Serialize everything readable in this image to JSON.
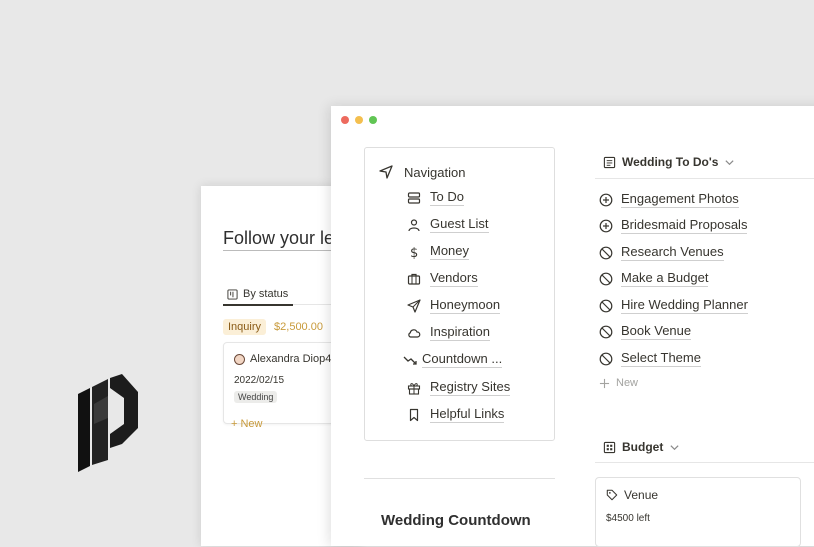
{
  "logo": {
    "name": "brand-logo"
  },
  "back_window": {
    "title": "Follow your le",
    "tab": {
      "label": "By status",
      "icon": "board-icon"
    },
    "group": {
      "status": "Inquiry",
      "amount": "$2,500.00"
    },
    "card": {
      "person": "Alexandra Diop4",
      "date": "2022/02/15",
      "tag": "Wedding"
    },
    "new_label": "+ New"
  },
  "front_window": {
    "traffic_lights": [
      "#ed6a5e",
      "#f4bf4f",
      "#61c554"
    ],
    "navigation": {
      "title": "Navigation",
      "icon": "navigation-arrow-icon",
      "items": [
        {
          "label": "To Do",
          "icon": "stack-icon"
        },
        {
          "label": "Guest List",
          "icon": "person-icon"
        },
        {
          "label": "Money",
          "icon": "dollar-icon"
        },
        {
          "label": "Vendors",
          "icon": "briefcase-icon"
        },
        {
          "label": "Honeymoon",
          "icon": "send-icon"
        },
        {
          "label": "Inspiration",
          "icon": "cloud-icon"
        },
        {
          "label": "Countdown ...",
          "icon": "trend-down-icon"
        },
        {
          "label": "Registry Sites",
          "icon": "gift-icon"
        },
        {
          "label": "Helpful Links",
          "icon": "bookmark-icon"
        }
      ]
    },
    "countdown_title": "Wedding Countdown",
    "todo": {
      "title": "Wedding To Do's",
      "items": [
        {
          "label": "Engagement Photos",
          "icon": "plus-circle-icon"
        },
        {
          "label": "Bridesmaid Proposals",
          "icon": "plus-circle-icon"
        },
        {
          "label": "Research Venues",
          "icon": "block-icon"
        },
        {
          "label": "Make a Budget",
          "icon": "block-icon"
        },
        {
          "label": "Hire Wedding Planner",
          "icon": "block-icon"
        },
        {
          "label": "Book Venue",
          "icon": "block-icon"
        },
        {
          "label": "Select Theme",
          "icon": "block-icon"
        }
      ],
      "new_label": "New"
    },
    "budget": {
      "title": "Budget",
      "card": {
        "name": "Venue",
        "left": "$4500 left"
      }
    }
  }
}
